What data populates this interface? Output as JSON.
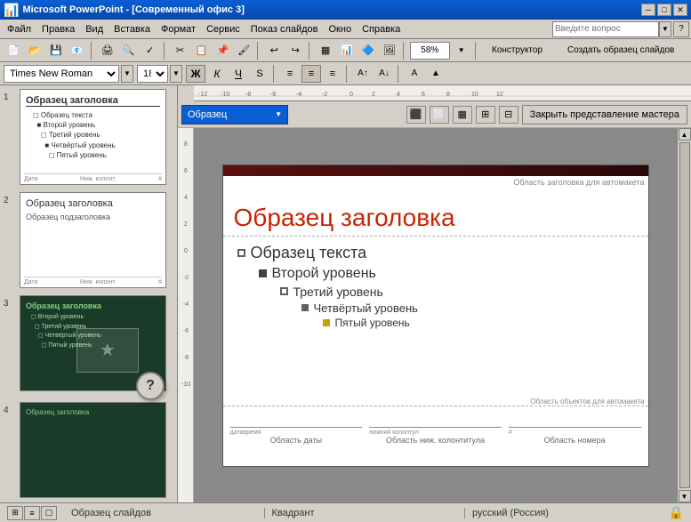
{
  "window": {
    "title": "Microsoft PowerPoint - [Современный офис 3]",
    "icon": "📊"
  },
  "titlebar": {
    "title": "Microsoft PowerPoint - [Современный офис 3]",
    "min": "─",
    "max": "□",
    "close": "✕"
  },
  "menubar": {
    "items": [
      "Файл",
      "Правка",
      "Вид",
      "Вставка",
      "Формат",
      "Сервис",
      "Показ слайдов",
      "Окно",
      "Справка"
    ],
    "search_placeholder": "Введите вопрос"
  },
  "font_toolbar": {
    "font_name": "Times New Roman",
    "font_size": "18",
    "bold": "Ж",
    "italic": "К",
    "underline": "Ч",
    "strikethrough": "S"
  },
  "slide_panel": {
    "slides": [
      {
        "num": "1",
        "theme": "light"
      },
      {
        "num": "2",
        "theme": "light"
      },
      {
        "num": "3",
        "theme": "dark"
      },
      {
        "num": "4",
        "theme": "dark"
      }
    ]
  },
  "obrazets_bar": {
    "dropdown_label": "Образец",
    "close_btn": "Закрыть представление мастера"
  },
  "slide_canvas": {
    "title_placeholder": "Область заголовка для автомакета",
    "title_text": "Образец заголовка",
    "content_placeholder": "Область объектов для автомакета",
    "bullet1": "Образец текста",
    "bullet2": "Второй уровень",
    "bullet3": "Третий уровень",
    "bullet4": "Четвёртый уровень",
    "bullet5": "Пятый уровень",
    "footer_date_label": "датавремя",
    "footer_date": "Область даты",
    "footer_col_label": "нижний колонтул",
    "footer_col": "Область ниж. колонтитула",
    "footer_num_label": "#",
    "footer_num": "Область номера"
  },
  "status_bar": {
    "slide_info": "Образец слайдов",
    "position": "Квадрант",
    "language": "русский (Россия)"
  },
  "zoom": "58%"
}
